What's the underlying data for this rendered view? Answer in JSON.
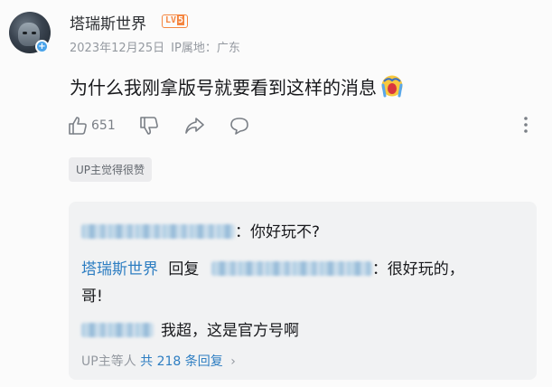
{
  "comment": {
    "username": "塔瑞斯世界",
    "level": {
      "prefix": "LV",
      "number": "5"
    },
    "date": "2023年12月25日",
    "ip_location": "IP属地：广东",
    "text": "为什么我刚拿版号就要看到这样的消息",
    "emoji_icon": "crying-face-icon",
    "like_count": "651",
    "up_badge": "UP主觉得很赞"
  },
  "replies": {
    "reply1_text": "：你好玩不?",
    "reply2_author": "塔瑞斯世界",
    "reply2_verb": "回复",
    "reply2_text": "：很好玩的，",
    "reply2_text_line2": "哥!",
    "reply3_text": "我超，这是官方号啊",
    "more_prefix": "UP主等人",
    "more_count": "共 218 条回复",
    "more_arrow": "›"
  },
  "colors": {
    "accent_blue": "#2e7ec2",
    "level_orange": "#f5853f",
    "meta_gray": "#9499a0"
  }
}
